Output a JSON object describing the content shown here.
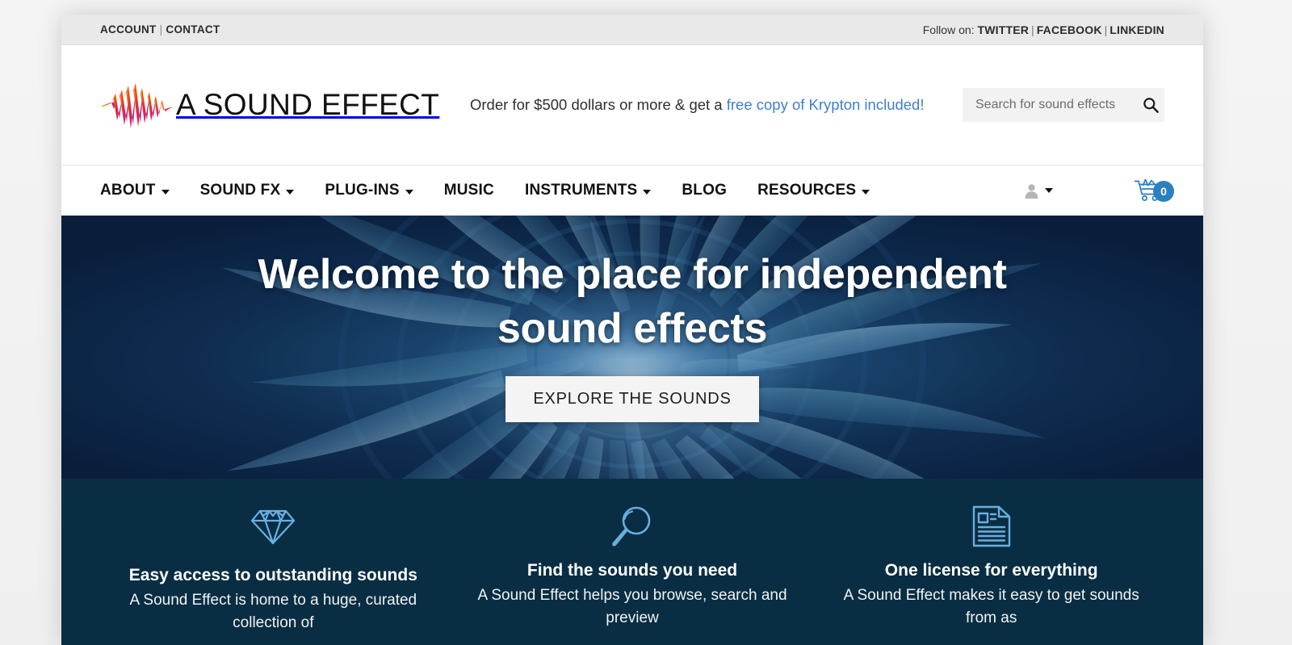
{
  "topbar": {
    "account_label": "ACCOUNT",
    "separator": "|",
    "contact_label": "CONTACT",
    "follow_label": "Follow on:",
    "social": [
      {
        "label": "TWITTER"
      },
      {
        "label": "FACEBOOK"
      },
      {
        "label": "LINKEDIN"
      }
    ]
  },
  "header": {
    "logo_text": "A SOUND EFFECT",
    "logo_icon": "waveform-logo-icon",
    "promo_text": "Order for $500 dollars or more & get a ",
    "promo_link": "free copy of Krypton included!",
    "search": {
      "placeholder": "Search for sound effects",
      "value": "",
      "icon": "search-icon"
    }
  },
  "nav": {
    "items": [
      {
        "label": "ABOUT",
        "has_dropdown": true
      },
      {
        "label": "SOUND FX",
        "has_dropdown": true
      },
      {
        "label": "PLUG-INS",
        "has_dropdown": true
      },
      {
        "label": "MUSIC",
        "has_dropdown": false
      },
      {
        "label": "INSTRUMENTS",
        "has_dropdown": true
      },
      {
        "label": "BLOG",
        "has_dropdown": false
      },
      {
        "label": "RESOURCES",
        "has_dropdown": true
      }
    ],
    "account_icon": "user-icon",
    "cart_icon": "shopping-cart-icon",
    "cart_count": "0"
  },
  "hero": {
    "title": "Welcome to the place for independent sound effects",
    "cta_label": "EXPLORE THE SOUNDS",
    "background": "blue-radial-swirl"
  },
  "features": [
    {
      "icon": "diamond-icon",
      "title": "Easy access to outstanding sounds",
      "desc": "A Sound Effect is home to a huge, curated collection of"
    },
    {
      "icon": "magnifier-icon",
      "title": "Find the sounds you need",
      "desc": "A Sound Effect helps you browse, search and preview"
    },
    {
      "icon": "license-document-icon",
      "title": "One license for everything",
      "desc": "A Sound Effect makes it easy to get sounds from as"
    }
  ],
  "colors": {
    "topbar_bg": "#e9e9e9",
    "page_bg": "#f1f1f1",
    "link_blue": "#3c7fd0",
    "cart_blue": "#2a7fc0",
    "hero_navy": "#0d2340",
    "features_navy": "#092e43",
    "feature_icon_blue": "#6aaee0"
  }
}
